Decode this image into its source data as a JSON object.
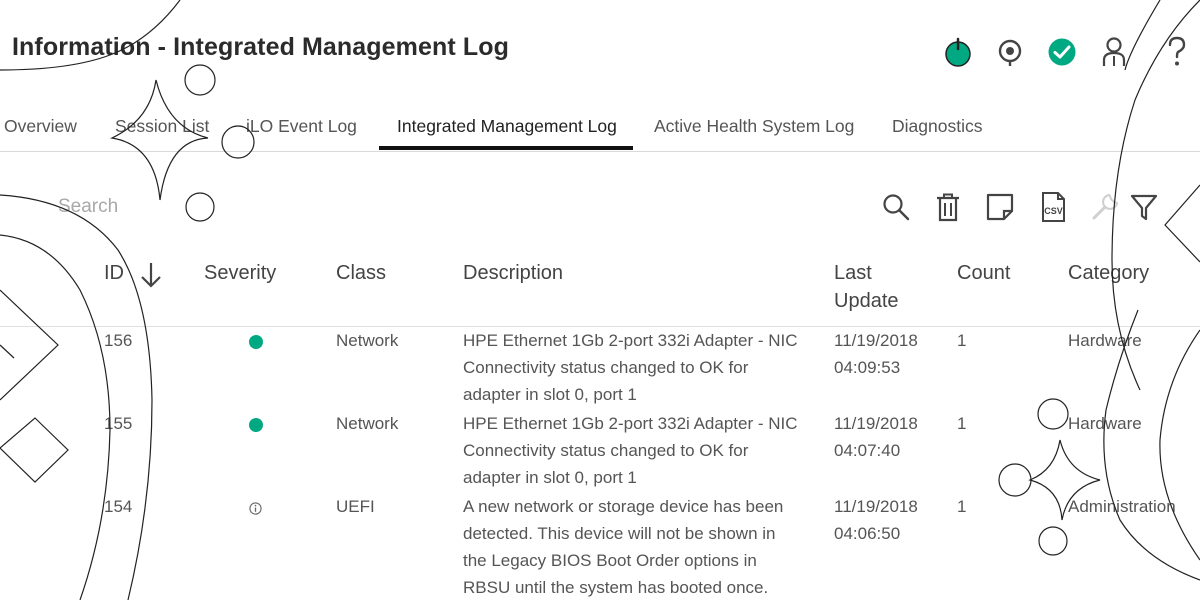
{
  "header": {
    "title": "Information - Integrated Management Log",
    "icons": [
      "power-icon",
      "locate-icon",
      "health-ok-icon",
      "user-icon",
      "help-icon"
    ],
    "colors": {
      "power": "#01a982",
      "health": "#01a982"
    }
  },
  "tabs": [
    {
      "label": "Overview",
      "active": false
    },
    {
      "label": "Session List",
      "active": false
    },
    {
      "label": "iLO Event Log",
      "active": false
    },
    {
      "label": "Integrated Management Log",
      "active": true
    },
    {
      "label": "Active Health System Log",
      "active": false
    },
    {
      "label": "Diagnostics",
      "active": false
    }
  ],
  "search": {
    "placeholder": "Search",
    "value": ""
  },
  "toolbar": {
    "icons": [
      "search-icon",
      "delete-icon",
      "note-icon",
      "csv-icon",
      "wrench-icon",
      "filter-icon"
    ],
    "csv_label": "CSV"
  },
  "table": {
    "sort_icon": "arrow-down-icon",
    "columns": {
      "id": "ID",
      "severity": "Severity",
      "class": "Class",
      "description": "Description",
      "last_update_1": "Last",
      "last_update_2": "Update",
      "count": "Count",
      "category": "Category"
    },
    "rows": [
      {
        "id": "156",
        "severity": "ok",
        "class": "Network",
        "description": [
          "HPE Ethernet 1Gb 2-port 332i Adapter - NIC",
          "Connectivity status changed to OK for",
          "adapter in slot 0, port 1"
        ],
        "date": "11/19/2018",
        "time": "04:09:53",
        "count": "1",
        "category": "Hardware"
      },
      {
        "id": "155",
        "severity": "ok",
        "class": "Network",
        "description": [
          "HPE Ethernet 1Gb 2-port 332i Adapter - NIC",
          "Connectivity status changed to OK for",
          "adapter in slot 0, port 1"
        ],
        "date": "11/19/2018",
        "time": "04:07:40",
        "count": "1",
        "category": "Hardware"
      },
      {
        "id": "154",
        "severity": "informational",
        "class": "UEFI",
        "description": [
          "A new network or storage device has been",
          "detected. This device will not be shown in",
          "the Legacy BIOS Boot Order options in",
          "RBSU until the system has booted once."
        ],
        "date": "11/19/2018",
        "time": "04:06:50",
        "count": "1",
        "category": "Administration"
      }
    ]
  }
}
